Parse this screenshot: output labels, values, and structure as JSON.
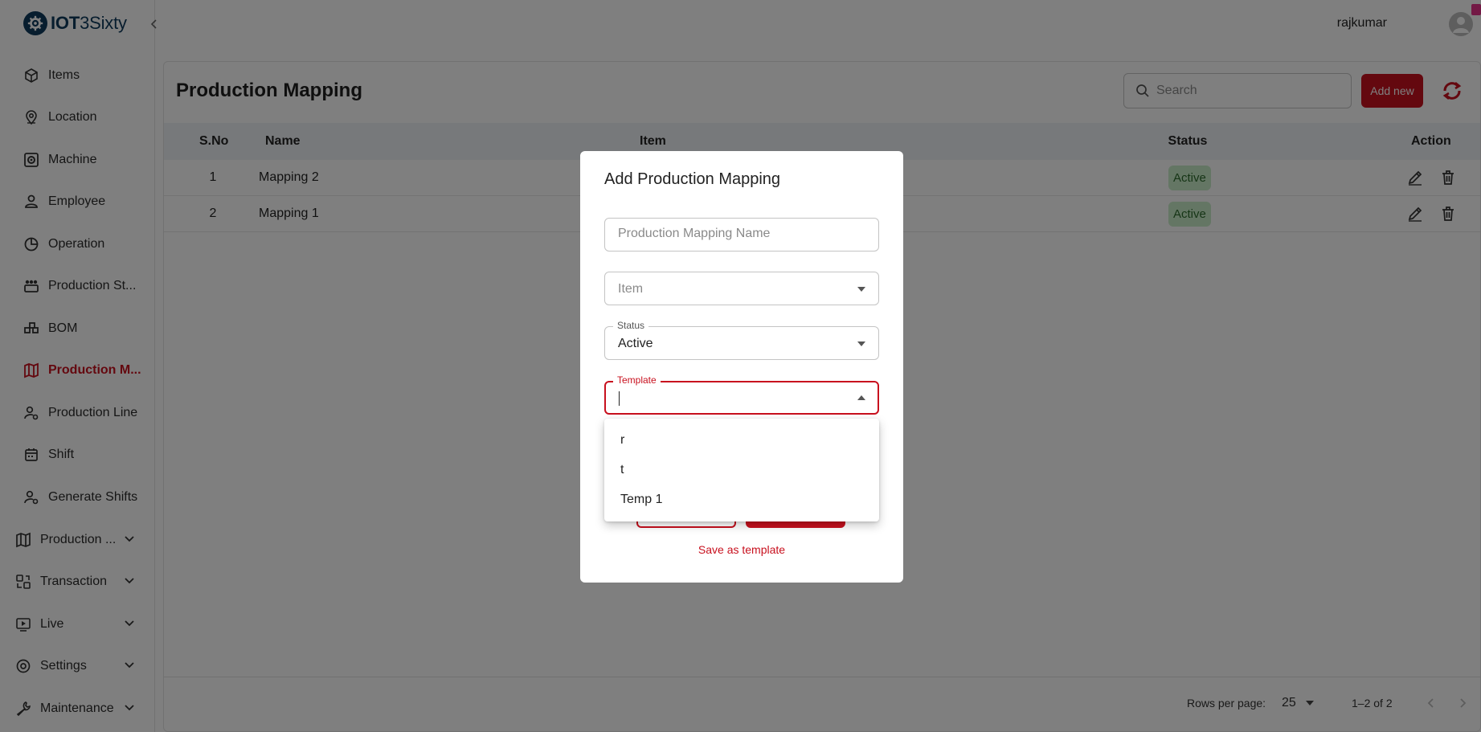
{
  "app": {
    "brand_bold": "IOT",
    "brand_rest": "3Sixty"
  },
  "user": {
    "name": "rajkumar"
  },
  "sidebar": {
    "items": [
      {
        "label": "Items",
        "icon": "package-icon"
      },
      {
        "label": "Location",
        "icon": "map-pin-icon"
      },
      {
        "label": "Machine",
        "icon": "machine-icon"
      },
      {
        "label": "Employee",
        "icon": "person-icon"
      },
      {
        "label": "Operation",
        "icon": "pie-icon"
      },
      {
        "label": "Production St...",
        "icon": "group-icon"
      },
      {
        "label": "BOM",
        "icon": "bom-icon"
      },
      {
        "label": "Production M...",
        "icon": "map-icon",
        "active": true
      },
      {
        "label": "Production Line",
        "icon": "user-gear-icon"
      },
      {
        "label": "Shift",
        "icon": "calendar-icon"
      },
      {
        "label": "Generate Shifts",
        "icon": "user-gear-icon"
      }
    ],
    "groups": [
      {
        "label": "Production ...",
        "icon": "map-icon"
      },
      {
        "label": "Transaction",
        "icon": "transfer-icon"
      },
      {
        "label": "Live",
        "icon": "live-icon"
      },
      {
        "label": "Settings",
        "icon": "gear-icon"
      },
      {
        "label": "Maintenance",
        "icon": "wrench-icon"
      }
    ]
  },
  "page": {
    "title": "Production Mapping",
    "search_placeholder": "Search",
    "add_label": "Add new"
  },
  "table": {
    "columns": {
      "sno": "S.No",
      "name": "Name",
      "item": "Item",
      "status": "Status",
      "action": "Action"
    },
    "rows": [
      {
        "sno": "1",
        "name": "Mapping 2",
        "item": "",
        "status": "Active"
      },
      {
        "sno": "2",
        "name": "Mapping 1",
        "item": "",
        "status": "Active"
      }
    ]
  },
  "pagination": {
    "rows_per_page_label": "Rows per page:",
    "rows_per_page": "25",
    "range": "1–2 of 2"
  },
  "modal": {
    "title": "Add Production Mapping",
    "name_placeholder": "Production Mapping Name",
    "item_placeholder": "Item",
    "status_label": "Status",
    "status_value": "Active",
    "template_label": "Template",
    "template_value": "",
    "save_template_label": "Save as template"
  },
  "template_options": [
    "r",
    "t",
    "Temp 1"
  ],
  "colors": {
    "accent": "#c8101e",
    "brand": "#0e3a5c",
    "active_badge_bg": "#c8ecc8",
    "active_badge_text": "#2d6b2d"
  }
}
